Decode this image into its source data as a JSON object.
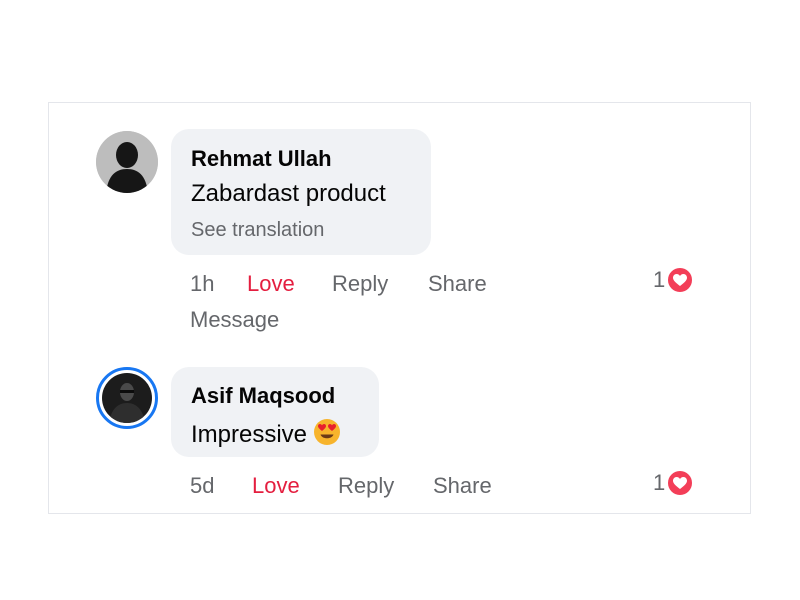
{
  "comments": [
    {
      "author": "Rehmat Ullah",
      "text": "Zabardast product",
      "see_translation": "See translation",
      "time": "1h",
      "actions": {
        "love": "Love",
        "reply": "Reply",
        "share": "Share",
        "message": "Message"
      },
      "reaction_count": "1",
      "reaction_icon": "heart-icon"
    },
    {
      "author": "Asif Maqsood",
      "text": "Impressive",
      "emoji_icon": "heart-eyes-emoji-icon",
      "time": "5d",
      "actions": {
        "love": "Love",
        "reply": "Reply",
        "share": "Share"
      },
      "reaction_count": "1",
      "reaction_icon": "heart-icon"
    }
  ],
  "colors": {
    "love": "#e41e3f",
    "muted": "#65676b",
    "bubble": "#f0f2f5",
    "story_ring": "#1877f2",
    "reaction": "#f33e58"
  }
}
